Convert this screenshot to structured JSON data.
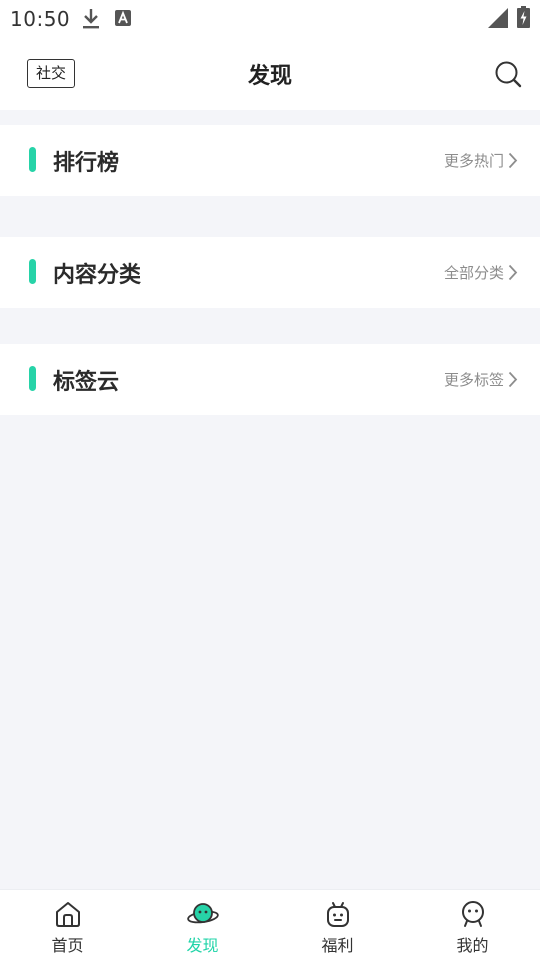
{
  "status_bar": {
    "time": "10:50"
  },
  "header": {
    "left_button": "社交",
    "title": "发现"
  },
  "sections": [
    {
      "title": "排行榜",
      "more": "更多热门"
    },
    {
      "title": "内容分类",
      "more": "全部分类"
    },
    {
      "title": "标签云",
      "more": "更多标签"
    }
  ],
  "tabs": [
    {
      "label": "首页",
      "icon": "home-icon"
    },
    {
      "label": "发现",
      "icon": "planet-icon",
      "active": true
    },
    {
      "label": "福利",
      "icon": "gift-robot-icon"
    },
    {
      "label": "我的",
      "icon": "profile-icon"
    }
  ],
  "colors": {
    "accent": "#27d3a8",
    "active_tab": "#20d4a8",
    "page_background": "#f4f5f9"
  }
}
